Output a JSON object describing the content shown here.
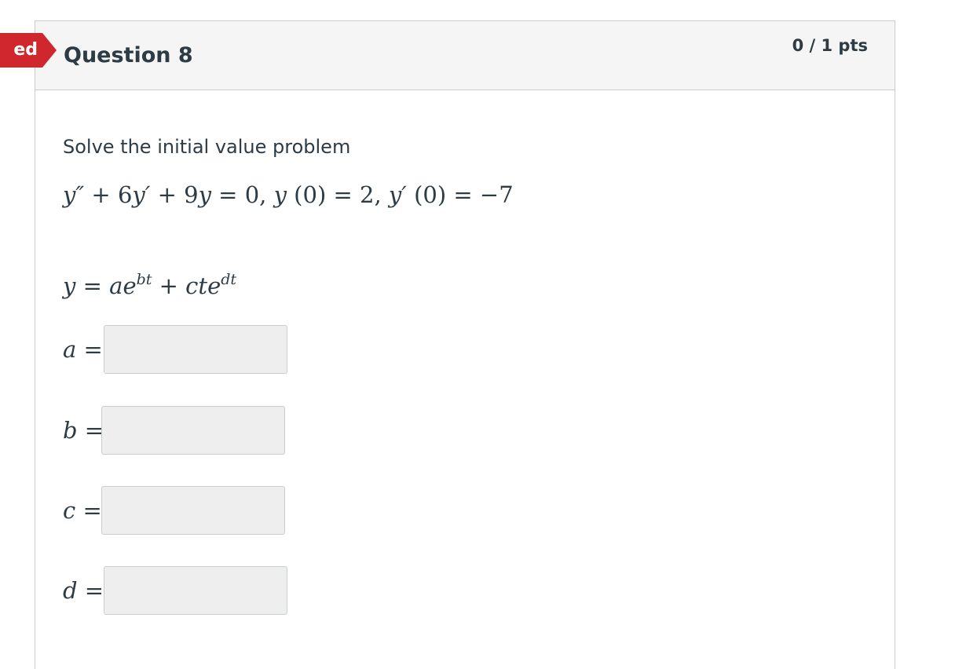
{
  "status_flag": {
    "text": "ed",
    "color": "#d0262e"
  },
  "question": {
    "title": "Question 8",
    "points": "0 / 1 pts",
    "prompt": "Solve the initial value problem",
    "equation_parts": {
      "y_dd": "y″",
      "plus1": " + 6",
      "y_d": "y′",
      "plus2": " + 9",
      "y": "y",
      "eq0": " = 0,  ",
      "y0": "y",
      "y0_val": " (0) = 2,  ",
      "yp0": "y′",
      "yp0_val": " (0) = −7"
    },
    "solution_form": {
      "lhs": "y",
      "eq": " = ",
      "a": "a",
      "e1": "e",
      "exp1": "bt",
      "plus": " + ",
      "c": "c",
      "t": "t",
      "e2": "e",
      "exp2": "dt"
    },
    "answers": [
      {
        "var": "a",
        "value": ""
      },
      {
        "var": "b",
        "value": ""
      },
      {
        "var": "c",
        "value": ""
      },
      {
        "var": "d",
        "value": ""
      }
    ],
    "equals": "="
  }
}
